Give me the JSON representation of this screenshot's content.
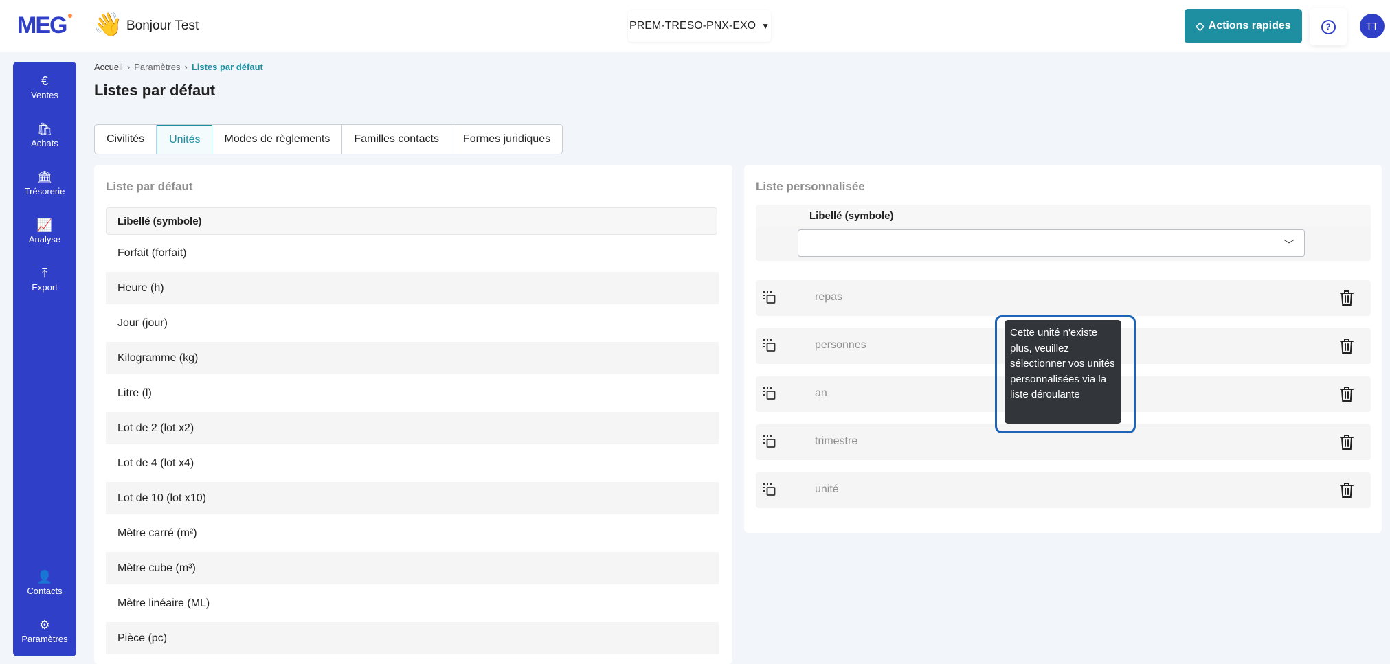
{
  "header": {
    "logo": "MEG",
    "greeting_icon": "waving-hand-icon",
    "greeting": "Bonjour Test",
    "company": "PREM-TRESO-PNX-EXO",
    "quick_actions": "Actions rapides",
    "user_initials": "TT"
  },
  "sidebar": {
    "top_items": [
      {
        "label": "Ventes",
        "icon": "euro-icon"
      },
      {
        "label": "Achats",
        "icon": "shopping-bag-icon"
      },
      {
        "label": "Trésorerie",
        "icon": "bank-icon"
      },
      {
        "label": "Analyse",
        "icon": "chart-icon"
      },
      {
        "label": "Export",
        "icon": "export-icon"
      }
    ],
    "bottom_items": [
      {
        "label": "Contacts",
        "icon": "contacts-icon"
      },
      {
        "label": "Paramètres",
        "icon": "gear-icon"
      }
    ]
  },
  "breadcrumb": {
    "home": "Accueil",
    "settings": "Paramètres",
    "current": "Listes par défaut"
  },
  "page_title": "Listes par défaut",
  "tabs": [
    {
      "label": "Civilités",
      "active": false
    },
    {
      "label": "Unités",
      "active": true
    },
    {
      "label": "Modes de règlements",
      "active": false
    },
    {
      "label": "Familles contacts",
      "active": false
    },
    {
      "label": "Formes juridiques",
      "active": false
    }
  ],
  "default_list": {
    "title": "Liste par défaut",
    "column": "Libellé (symbole)",
    "rows": [
      "Forfait (forfait)",
      "Heure (h)",
      "Jour (jour)",
      "Kilogramme (kg)",
      "Litre (l)",
      "Lot de 2 (lot x2)",
      "Lot de 4 (lot x4)",
      "Lot de 10 (lot x10)",
      "Mètre carré (m²)",
      "Mètre cube (m³)",
      "Mètre linéaire (ML)",
      "Pièce (pc)"
    ]
  },
  "custom_list": {
    "title": "Liste personnalisée",
    "column": "Libellé (symbole)",
    "select_value": "",
    "rows": [
      "repas",
      "personnes",
      "an",
      "trimestre",
      "unité"
    ]
  },
  "tooltip": "Cette unité n'existe plus, veuillez sélectionner vos unités personnalisées via la liste déroulante",
  "colors": {
    "brand": "#2f3fc8",
    "accent": "#1e8fa0",
    "tooltip_bg": "#32363b",
    "highlight": "#1d64b8"
  }
}
